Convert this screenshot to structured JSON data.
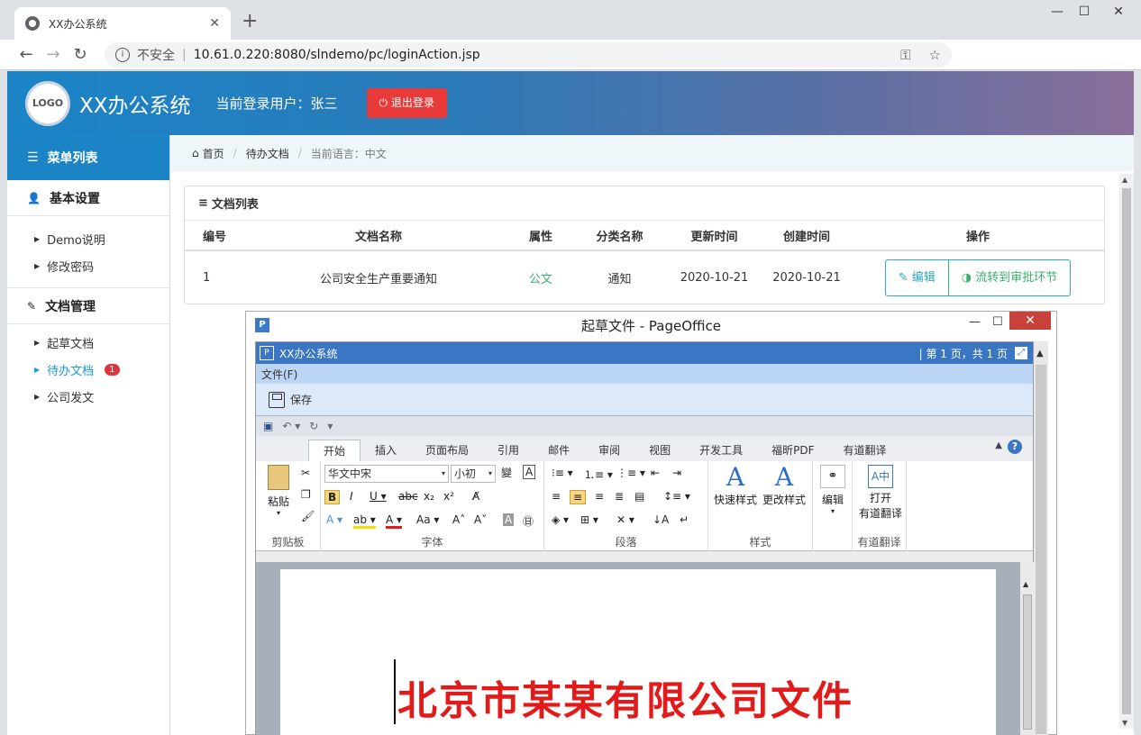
{
  "browser": {
    "tab_title": "XX办公系统",
    "tab_close": "✕",
    "new_tab": "+",
    "insecure_label": "不安全",
    "url": "10.61.0.220:8080/slndemo/pc/loginAction.jsp",
    "win_min": "—",
    "win_max": "☐",
    "win_close": "✕",
    "extension_colors": [
      "#1a73e8",
      "#3c5ab8",
      "#d93025"
    ]
  },
  "header": {
    "logo_text": "LOGO",
    "title": "XX办公系统",
    "current_user": "当前登录用户：张三",
    "logout_label": "⏻ 退出登录"
  },
  "sidebar": {
    "menu_title": "菜单列表",
    "groups": [
      {
        "label": "基本设置",
        "items": [
          {
            "label": "Demo说明"
          },
          {
            "label": "修改密码"
          }
        ]
      },
      {
        "label": "文档管理",
        "items": [
          {
            "label": "起草文档"
          },
          {
            "label": "待办文档",
            "badge": "1"
          },
          {
            "label": "公司发文"
          }
        ]
      }
    ]
  },
  "breadcrumb": {
    "home": "首页",
    "page": "待办文档",
    "language": "当前语言：中文"
  },
  "doc_list": {
    "title": "文档列表",
    "columns": [
      "编号",
      "文档名称",
      "属性",
      "分类名称",
      "更新时间",
      "创建时间",
      "操作"
    ],
    "rows": [
      {
        "id": "1",
        "name": "公司安全生产重要通知",
        "attr": "公文",
        "category": "通知",
        "updated": "2020-10-21",
        "created": "2020-10-21"
      }
    ],
    "edit_label": "编辑",
    "flow_label": "流转到审批环节"
  },
  "pageoffice": {
    "window_title": "起草文件 - PageOffice",
    "app_bar": "XX办公系统",
    "page_info": "| 第 1 页，共 1 页",
    "menu_file": "文件(F)",
    "save_label": "保存",
    "ribbon_tabs": [
      "开始",
      "插入",
      "页面布局",
      "引用",
      "邮件",
      "审阅",
      "视图",
      "开发工具",
      "福昕PDF",
      "有道翻译"
    ],
    "groups": {
      "clipboard": "剪贴板",
      "font": "字体",
      "paragraph": "段落",
      "styles": "样式",
      "editing": "编辑",
      "translate": "有道翻译"
    },
    "paste_label": "粘贴",
    "font_name": "华文中宋",
    "font_size": "小初",
    "quick_style": "快速样式",
    "change_style": "更改样式",
    "edit_label": "编辑",
    "open_translate": "打开",
    "translate_label": "有道翻译",
    "doc_heading": "北京市某某有限公司文件"
  }
}
